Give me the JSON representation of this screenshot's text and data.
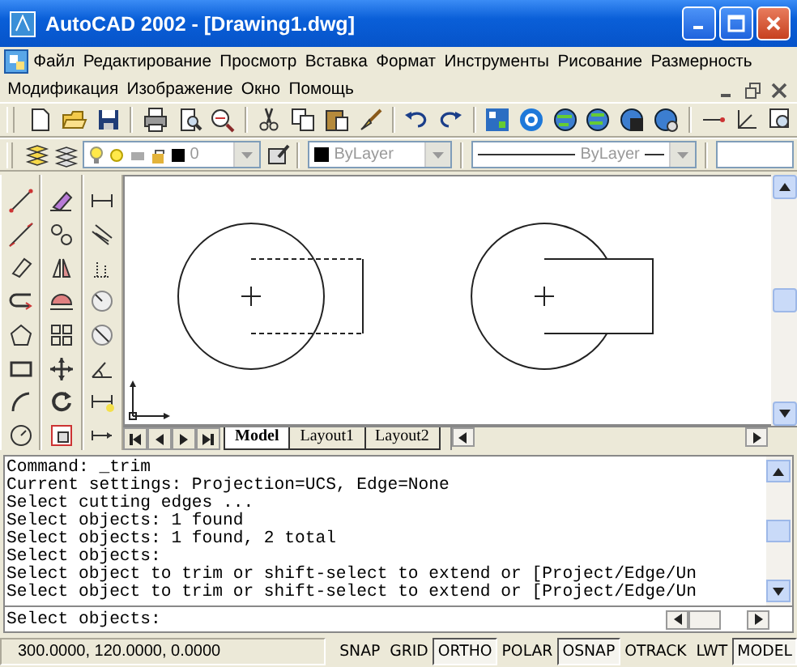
{
  "window": {
    "title": "AutoCAD 2002 - [Drawing1.dwg]"
  },
  "menu": [
    "Файл",
    "Редактирование",
    "Просмотр",
    "Вставка",
    "Формат",
    "Инструменты",
    "Рисование",
    "Размерность",
    "Модификация",
    "Изображение",
    "Окно",
    "Помощь"
  ],
  "layer_toolbar": {
    "layer": "0",
    "color_setting": "ByLayer",
    "linetype": "ByLayer"
  },
  "layout_tabs": [
    {
      "label": "Model",
      "selected": true
    },
    {
      "label": "Layout1",
      "selected": false
    },
    {
      "label": "Layout2",
      "selected": false
    }
  ],
  "command_history": [
    "Command: _trim",
    "Current settings: Projection=UCS, Edge=None",
    "Select cutting edges ...",
    "Select objects: 1 found",
    "Select objects: 1 found, 2 total",
    "Select objects:",
    "Select object to trim or shift-select to extend or [Project/Edge/Un",
    "Select object to trim or shift-select to extend or [Project/Edge/Un"
  ],
  "command_line": {
    "value": "Select objects:"
  },
  "status_bar": {
    "coordinates": "300.0000, 120.0000, 0.0000",
    "toggles": [
      {
        "label": "SNAP",
        "on": false
      },
      {
        "label": "GRID",
        "on": false
      },
      {
        "label": "ORTHO",
        "on": true
      },
      {
        "label": "POLAR",
        "on": false
      },
      {
        "label": "OSNAP",
        "on": true
      },
      {
        "label": "OTRACK",
        "on": false
      },
      {
        "label": "LWT",
        "on": false
      },
      {
        "label": "MODEL",
        "on": true
      }
    ]
  }
}
